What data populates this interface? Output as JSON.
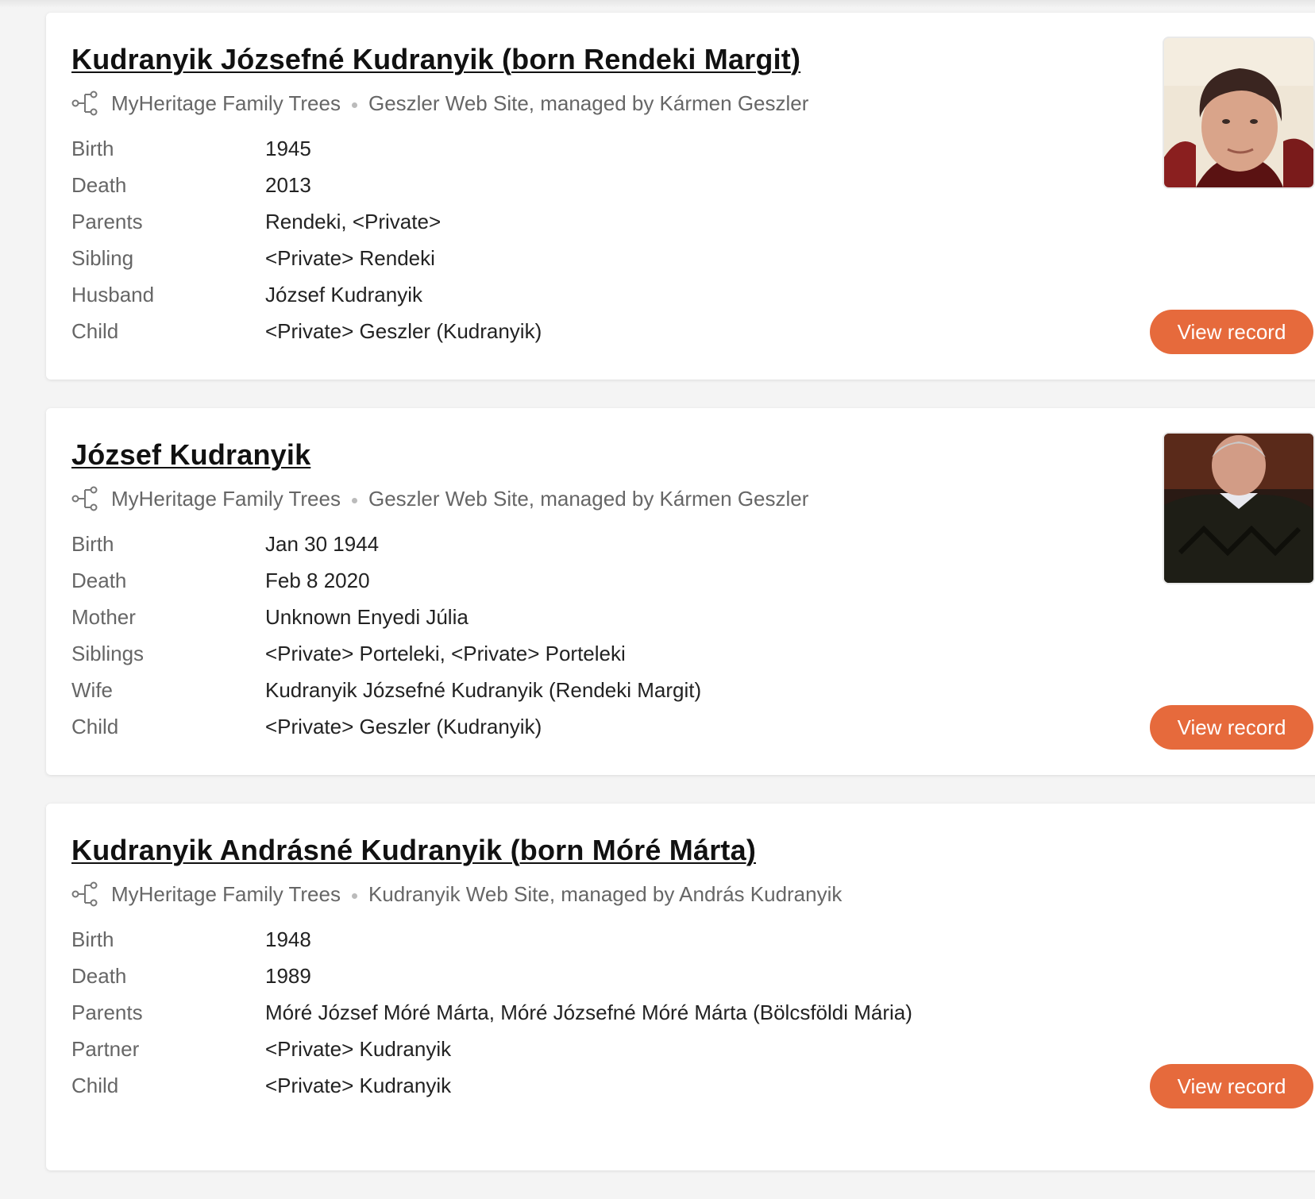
{
  "results": [
    {
      "name": "Kudranyik Józsefné Kudranyik (born Rendeki Margit)",
      "source": "MyHeritage Family Trees",
      "site": "Geszler Web Site, managed by Kármen Geszler",
      "photo": "photo-woman",
      "facts": [
        {
          "label": "Birth",
          "value": "1945"
        },
        {
          "label": "Death",
          "value": "2013"
        },
        {
          "label": "Parents",
          "value": "Rendeki, <Private>"
        },
        {
          "label": "Sibling",
          "value": "<Private> Rendeki"
        },
        {
          "label": "Husband",
          "value": "József Kudranyik"
        },
        {
          "label": "Child",
          "value": "<Private> Geszler (Kudranyik)"
        }
      ],
      "button": "View record"
    },
    {
      "name": "József Kudranyik",
      "source": "MyHeritage Family Trees",
      "site": "Geszler Web Site, managed by Kármen Geszler",
      "photo": "photo-man",
      "facts": [
        {
          "label": "Birth",
          "value": "Jan 30 1944"
        },
        {
          "label": "Death",
          "value": "Feb 8 2020"
        },
        {
          "label": "Mother",
          "value": "Unknown Enyedi Júlia"
        },
        {
          "label": "Siblings",
          "value": "<Private> Porteleki, <Private> Porteleki"
        },
        {
          "label": "Wife",
          "value": "Kudranyik Józsefné Kudranyik (Rendeki Margit)"
        },
        {
          "label": "Child",
          "value": "<Private> Geszler (Kudranyik)"
        }
      ],
      "button": "View record"
    },
    {
      "name": "Kudranyik Andrásné Kudranyik (born Móré Márta)",
      "source": "MyHeritage Family Trees",
      "site": "Kudranyik Web Site, managed by András Kudranyik",
      "photo": null,
      "facts": [
        {
          "label": "Birth",
          "value": "1948"
        },
        {
          "label": "Death",
          "value": "1989"
        },
        {
          "label": "Parents",
          "value": "Móré József Móré Márta, Móré Józsefné Móré Márta (Bölcsföldi Mária)"
        },
        {
          "label": "Partner",
          "value": "<Private> Kudranyik"
        },
        {
          "label": "Child",
          "value": "<Private> Kudranyik"
        }
      ],
      "button": "View record"
    }
  ],
  "colors": {
    "accent": "#e66a3c",
    "label": "#666666",
    "value": "#222222",
    "background": "#f4f4f4"
  },
  "icons": {
    "source": "family-tree-icon"
  }
}
